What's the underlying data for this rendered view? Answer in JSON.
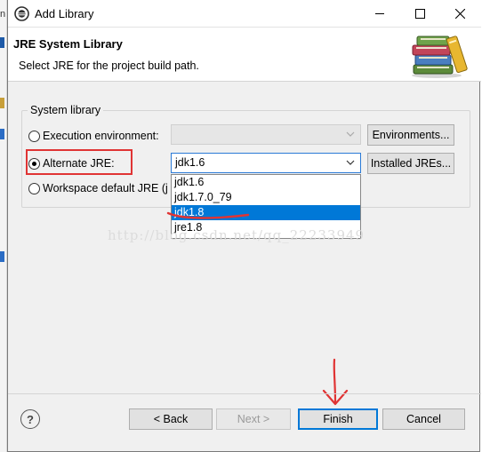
{
  "window": {
    "title": "Add Library"
  },
  "banner": {
    "title": "JRE System Library",
    "description": "Select JRE for the project build path."
  },
  "system_library": {
    "group_label": "System library",
    "options": [
      {
        "label": "Execution environment:",
        "checked": false
      },
      {
        "label": "Alternate JRE:",
        "checked": true
      },
      {
        "label": "Workspace default JRE (j",
        "checked": false
      }
    ],
    "execution_env_value": "",
    "alternate_jre_value": "jdk1.6",
    "environments_button": "Environments...",
    "installed_jres_button": "Installed JREs..."
  },
  "dropdown": {
    "items": [
      "jdk1.6",
      "jdk1.7.0_79",
      "jdk1.8",
      "jre1.8"
    ],
    "selected_index": 2
  },
  "watermark": "http://blog.csdn.net/qq_22233949",
  "footer": {
    "help_label": "?",
    "back_label": "< Back",
    "next_label": "Next >",
    "finish_label": "Finish",
    "cancel_label": "Cancel"
  },
  "colors": {
    "accent": "#0078d7",
    "annotation_red": "#e03434"
  }
}
